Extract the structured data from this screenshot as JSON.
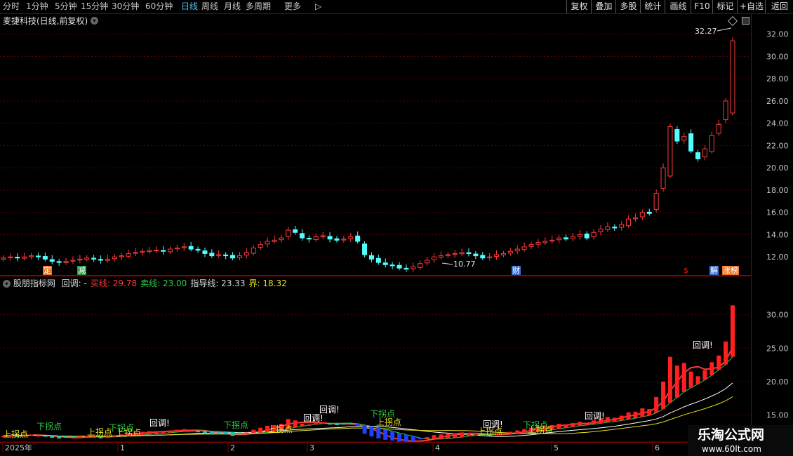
{
  "toolbar": {
    "periods": [
      "分时",
      "1分钟",
      "5分钟",
      "15分钟",
      "30分钟",
      "60分钟",
      "日线",
      "周线",
      "月线",
      "多周期",
      "更多"
    ],
    "active_period": "日线",
    "right_buttons": [
      "复权",
      "叠加",
      "多股",
      "统计",
      "画线",
      "F10",
      "标记",
      "+自选",
      "返回"
    ]
  },
  "main_chart": {
    "title": "麦捷科技(日线,前复权)",
    "high_label": "32.27",
    "low_label": "10.77",
    "y_ticks": [
      "32.00",
      "30.00",
      "28.00",
      "26.00",
      "24.00",
      "22.00",
      "20.00",
      "18.00",
      "16.00",
      "14.00",
      "12.00"
    ],
    "markers": [
      {
        "text": "定",
        "color": "#e8742a"
      },
      {
        "text": "减",
        "color": "#2f9c4a"
      },
      {
        "text": "财",
        "color": "#3d6fd1"
      },
      {
        "text": "$",
        "color": "#d12020"
      },
      {
        "text": "解",
        "color": "#3d6fd1"
      },
      {
        "text": "涨榜",
        "color": "#e8742a"
      }
    ]
  },
  "indicator": {
    "name": "股朋指标网",
    "items": [
      {
        "label": "回调: -",
        "color": "#d8d8d8"
      },
      {
        "label": "买线: 29.78",
        "color": "#ff3b3b"
      },
      {
        "label": "卖线: 23.00",
        "color": "#2ecc40"
      },
      {
        "label": "指导线: 23.33",
        "color": "#d8d8d8"
      },
      {
        "label": "界: 18.32",
        "color": "#e8e020"
      }
    ],
    "y_ticks": [
      "30.00",
      "25.00",
      "20.00",
      "15.00"
    ],
    "annotations": {
      "callback": "回调!",
      "up_turn": "上拐点",
      "down_turn": "下拐点"
    }
  },
  "x_axis": {
    "labels": [
      "2025年",
      "1",
      "2",
      "3",
      "4",
      "5",
      "6"
    ]
  },
  "watermark": {
    "title": "乐淘公式网",
    "url": "www.60lt.com"
  },
  "chart_data": {
    "type": "candlestick",
    "title": "麦捷科技(日线,前复权)",
    "ylim": [
      10.5,
      32.8
    ],
    "x_months": [
      "2025年",
      "1",
      "2",
      "3",
      "4",
      "5",
      "6"
    ],
    "closes": [
      11.9,
      12.0,
      11.9,
      12.0,
      12.1,
      12.0,
      11.8,
      11.6,
      11.5,
      11.6,
      11.7,
      11.8,
      11.9,
      11.8,
      11.7,
      11.8,
      12.0,
      12.1,
      12.3,
      12.4,
      12.5,
      12.6,
      12.6,
      12.5,
      12.7,
      12.8,
      12.9,
      12.7,
      12.6,
      12.3,
      12.1,
      12.2,
      12.1,
      11.9,
      12.1,
      12.4,
      12.8,
      13.1,
      13.4,
      13.5,
      13.7,
      14.4,
      14.2,
      13.7,
      13.6,
      13.8,
      13.9,
      13.6,
      13.5,
      13.6,
      13.8,
      13.4,
      12.2,
      11.8,
      11.5,
      11.3,
      11.2,
      11.0,
      10.9,
      11.1,
      11.4,
      11.7,
      12.0,
      12.1,
      12.2,
      12.3,
      12.4,
      12.3,
      12.1,
      11.9,
      12.0,
      12.2,
      12.3,
      12.5,
      12.7,
      12.9,
      13.1,
      13.3,
      13.4,
      13.5,
      13.7,
      13.6,
      13.8,
      14.0,
      13.7,
      14.2,
      14.5,
      14.7,
      14.6,
      14.9,
      15.4,
      15.5,
      16.0,
      15.9,
      17.7,
      20.0,
      23.7,
      22.4,
      22.8,
      21.5,
      20.8,
      21.7,
      22.9,
      23.9,
      26.0,
      31.4
    ]
  }
}
